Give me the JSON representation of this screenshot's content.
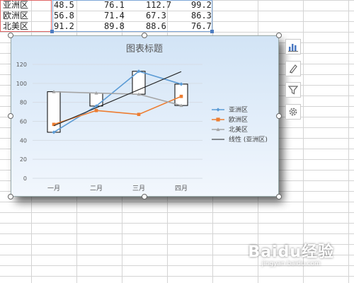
{
  "table": {
    "rows": [
      {
        "label": "亚洲区",
        "values": [
          "48.5",
          "76.1",
          "112.7",
          "99.2"
        ]
      },
      {
        "label": "欧洲区",
        "values": [
          "56.8",
          "71.4",
          "67.3",
          "86.3"
        ]
      },
      {
        "label": "北美区",
        "values": [
          "91.2",
          "89.8",
          "88.6",
          "76.7"
        ]
      }
    ]
  },
  "chart_data": {
    "type": "line",
    "title": "图表标题",
    "categories": [
      "一月",
      "二月",
      "三月",
      "四月"
    ],
    "ylim": [
      0,
      120
    ],
    "yticks": [
      "0",
      "20",
      "40",
      "60",
      "80",
      "100",
      "120"
    ],
    "grid": true,
    "legend_position": "right",
    "series": [
      {
        "name": "亚洲区",
        "values": [
          48.5,
          76.1,
          112.7,
          99.2
        ],
        "color": "#5b9bd5",
        "marker": "diamond"
      },
      {
        "name": "欧洲区",
        "values": [
          56.8,
          71.4,
          67.3,
          86.3
        ],
        "color": "#ed7d31",
        "marker": "square"
      },
      {
        "name": "北美区",
        "values": [
          91.2,
          89.8,
          88.6,
          76.7
        ],
        "color": "#a5a5a5",
        "marker": "triangle"
      }
    ],
    "trendline": {
      "name": "线性 (亚洲区)",
      "color": "#222222",
      "start": 55.3,
      "end": 112.4
    },
    "updown_bars": true
  },
  "toolbar": {
    "icons": [
      "chart-elements-icon",
      "chart-styles-icon",
      "chart-filters-icon",
      "settings-icon"
    ]
  },
  "watermark": {
    "main": "Baidu经验",
    "sub": "jingyan.baidu.com"
  }
}
